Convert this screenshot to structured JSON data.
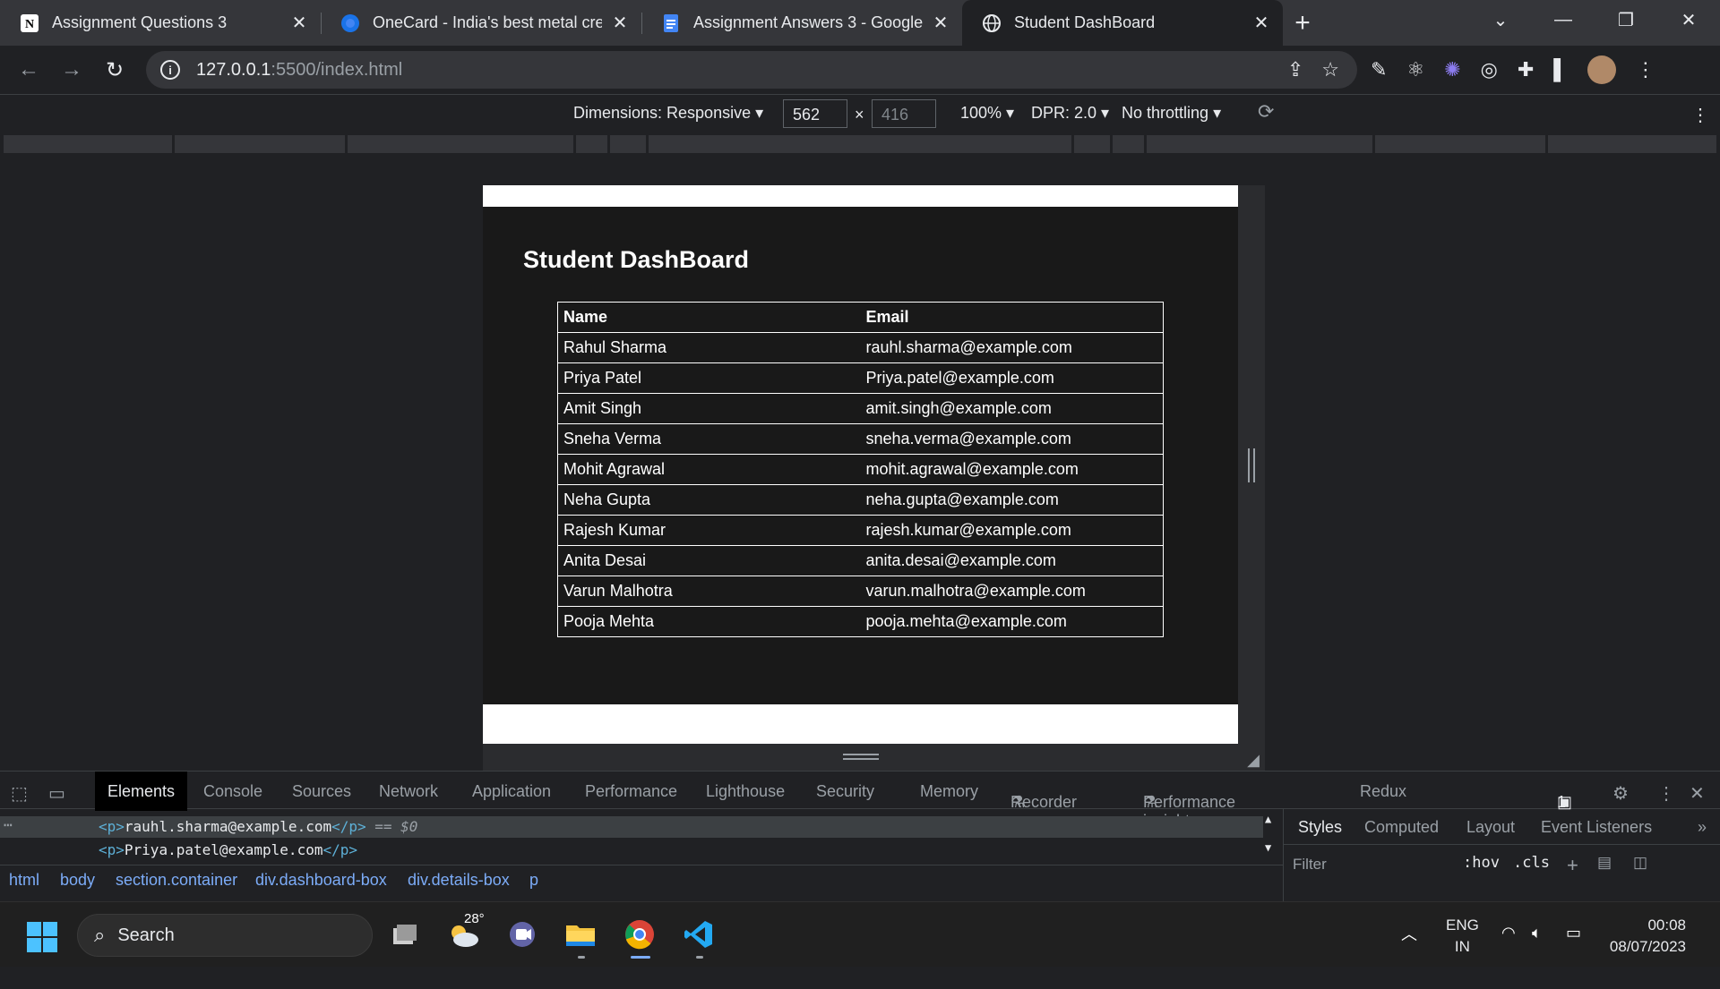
{
  "browser": {
    "tabs": [
      {
        "title": "Assignment Questions 3",
        "icon": "notion-icon"
      },
      {
        "title": "OneCard - India's best metal credit card",
        "icon": "onecard-icon"
      },
      {
        "title": "Assignment Answers 3 - Google Docs",
        "icon": "google-docs-icon"
      },
      {
        "title": "Student DashBoard",
        "icon": "globe-icon"
      }
    ],
    "active_tab_index": 3,
    "url_host": "127.0.0.1",
    "url_path": ":5500/index.html"
  },
  "device_toolbar": {
    "dimensions_label": "Dimensions: Responsive",
    "width": "562",
    "height": "416",
    "zoom": "100%",
    "dpr": "DPR: 2.0",
    "throttling": "No throttling"
  },
  "page": {
    "heading": "Student DashBoard",
    "columns": [
      "Name",
      "Email"
    ],
    "rows": [
      [
        "Rahul Sharma",
        "rauhl.sharma@example.com"
      ],
      [
        "Priya Patel",
        "Priya.patel@example.com"
      ],
      [
        "Amit Singh",
        "amit.singh@example.com"
      ],
      [
        "Sneha Verma",
        "sneha.verma@example.com"
      ],
      [
        "Mohit Agrawal",
        "mohit.agrawal@example.com"
      ],
      [
        "Neha Gupta",
        "neha.gupta@example.com"
      ],
      [
        "Rajesh Kumar",
        "rajesh.kumar@example.com"
      ],
      [
        "Anita Desai",
        "anita.desai@example.com"
      ],
      [
        "Varun Malhotra",
        "varun.malhotra@example.com"
      ],
      [
        "Pooja Mehta",
        "pooja.mehta@example.com"
      ]
    ]
  },
  "devtools": {
    "tabs": [
      "Elements",
      "Console",
      "Sources",
      "Network",
      "Application",
      "Performance",
      "Lighthouse",
      "Security",
      "Memory",
      "Recorder",
      "Performance insights",
      "Redux"
    ],
    "issues_count": "1",
    "code_line_1_text": "rauhl.sharma@example.com",
    "code_line_1_suffix": "== $0",
    "code_line_2_text": "Priya.patel@example.com",
    "breadcrumbs": [
      "html",
      "body",
      "section.container",
      "div.dashboard-box",
      "div.details-box",
      "p"
    ],
    "side_tabs": [
      "Styles",
      "Computed",
      "Layout",
      "Event Listeners"
    ],
    "filter_placeholder": "Filter",
    "hov": ":hov",
    "cls": ".cls"
  },
  "taskbar": {
    "search_label": "Search",
    "weather_temp": "28°",
    "lang_line1": "ENG",
    "lang_line2": "IN",
    "time": "00:08",
    "date": "08/07/2023"
  }
}
